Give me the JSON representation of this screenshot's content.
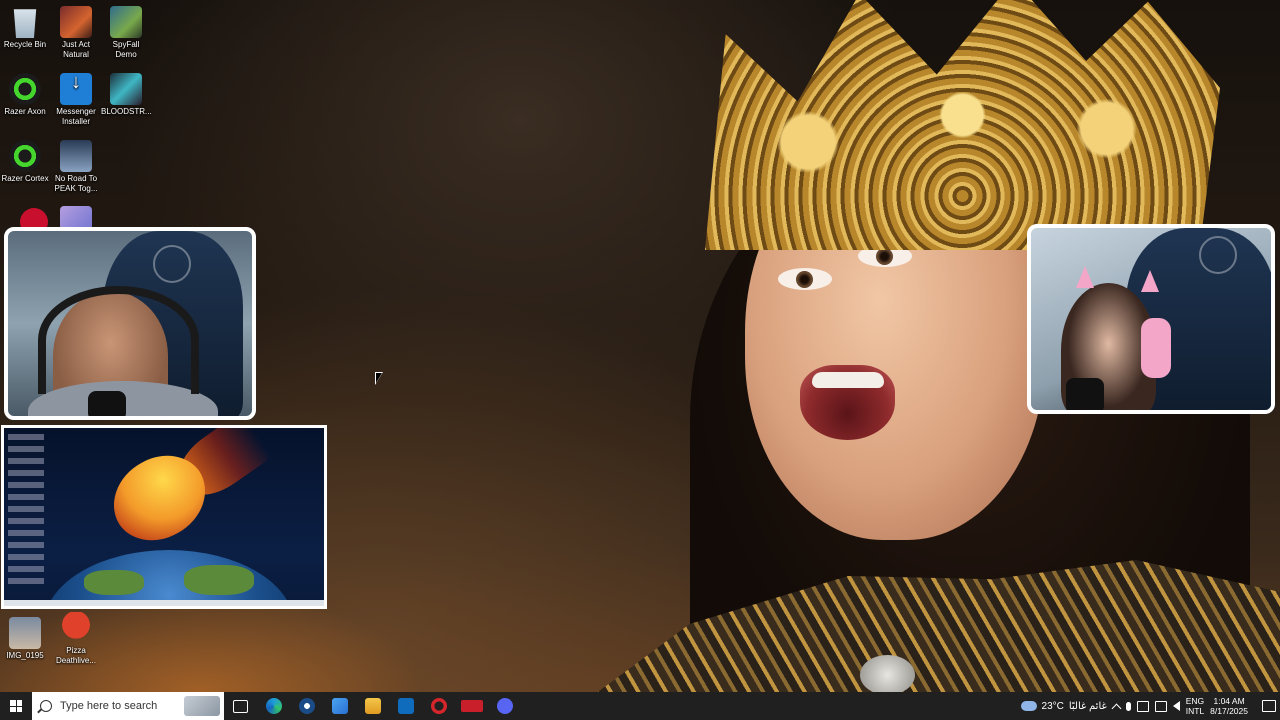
{
  "desktop": {
    "icons": [
      {
        "label": "Recycle Bin",
        "icon": "recycle-bin-icon"
      },
      {
        "label": "Just Act Natural",
        "icon": "game-icon"
      },
      {
        "label": "SpyFall Demo",
        "icon": "game-icon"
      },
      {
        "label": "Razer Axon",
        "icon": "razer-axon-icon"
      },
      {
        "label": "Messenger Installer",
        "icon": "messenger-installer-icon"
      },
      {
        "label": "BLOODSTR...",
        "icon": "game-icon"
      },
      {
        "label": "Razer Cortex",
        "icon": "razer-cortex-icon"
      },
      {
        "label": "No Road To PEAK Tog...",
        "icon": "peak-icon"
      },
      {
        "label": "IMG_0195",
        "icon": "image-file-icon"
      },
      {
        "label": "Pizza Deathlive...",
        "icon": "pizza-game-icon"
      }
    ]
  },
  "taskbar": {
    "search_placeholder": "Type here to search",
    "apps": [
      "task-view",
      "edge",
      "steam",
      "microsoft-store",
      "file-explorer",
      "outlook",
      "opera-gx",
      "voicemod",
      "discord"
    ],
    "voicemod_label": "VOICE\nMOD",
    "weather": {
      "temp": "23°C",
      "condition": "غائم غالبًا"
    },
    "language": {
      "line1": "ENG",
      "line2": "INTL"
    },
    "clock": {
      "time": "1:04 AM",
      "date": "8/17/2025"
    }
  },
  "colors": {
    "taskbar_bg": "#202020",
    "accent_green": "#44d62c"
  }
}
